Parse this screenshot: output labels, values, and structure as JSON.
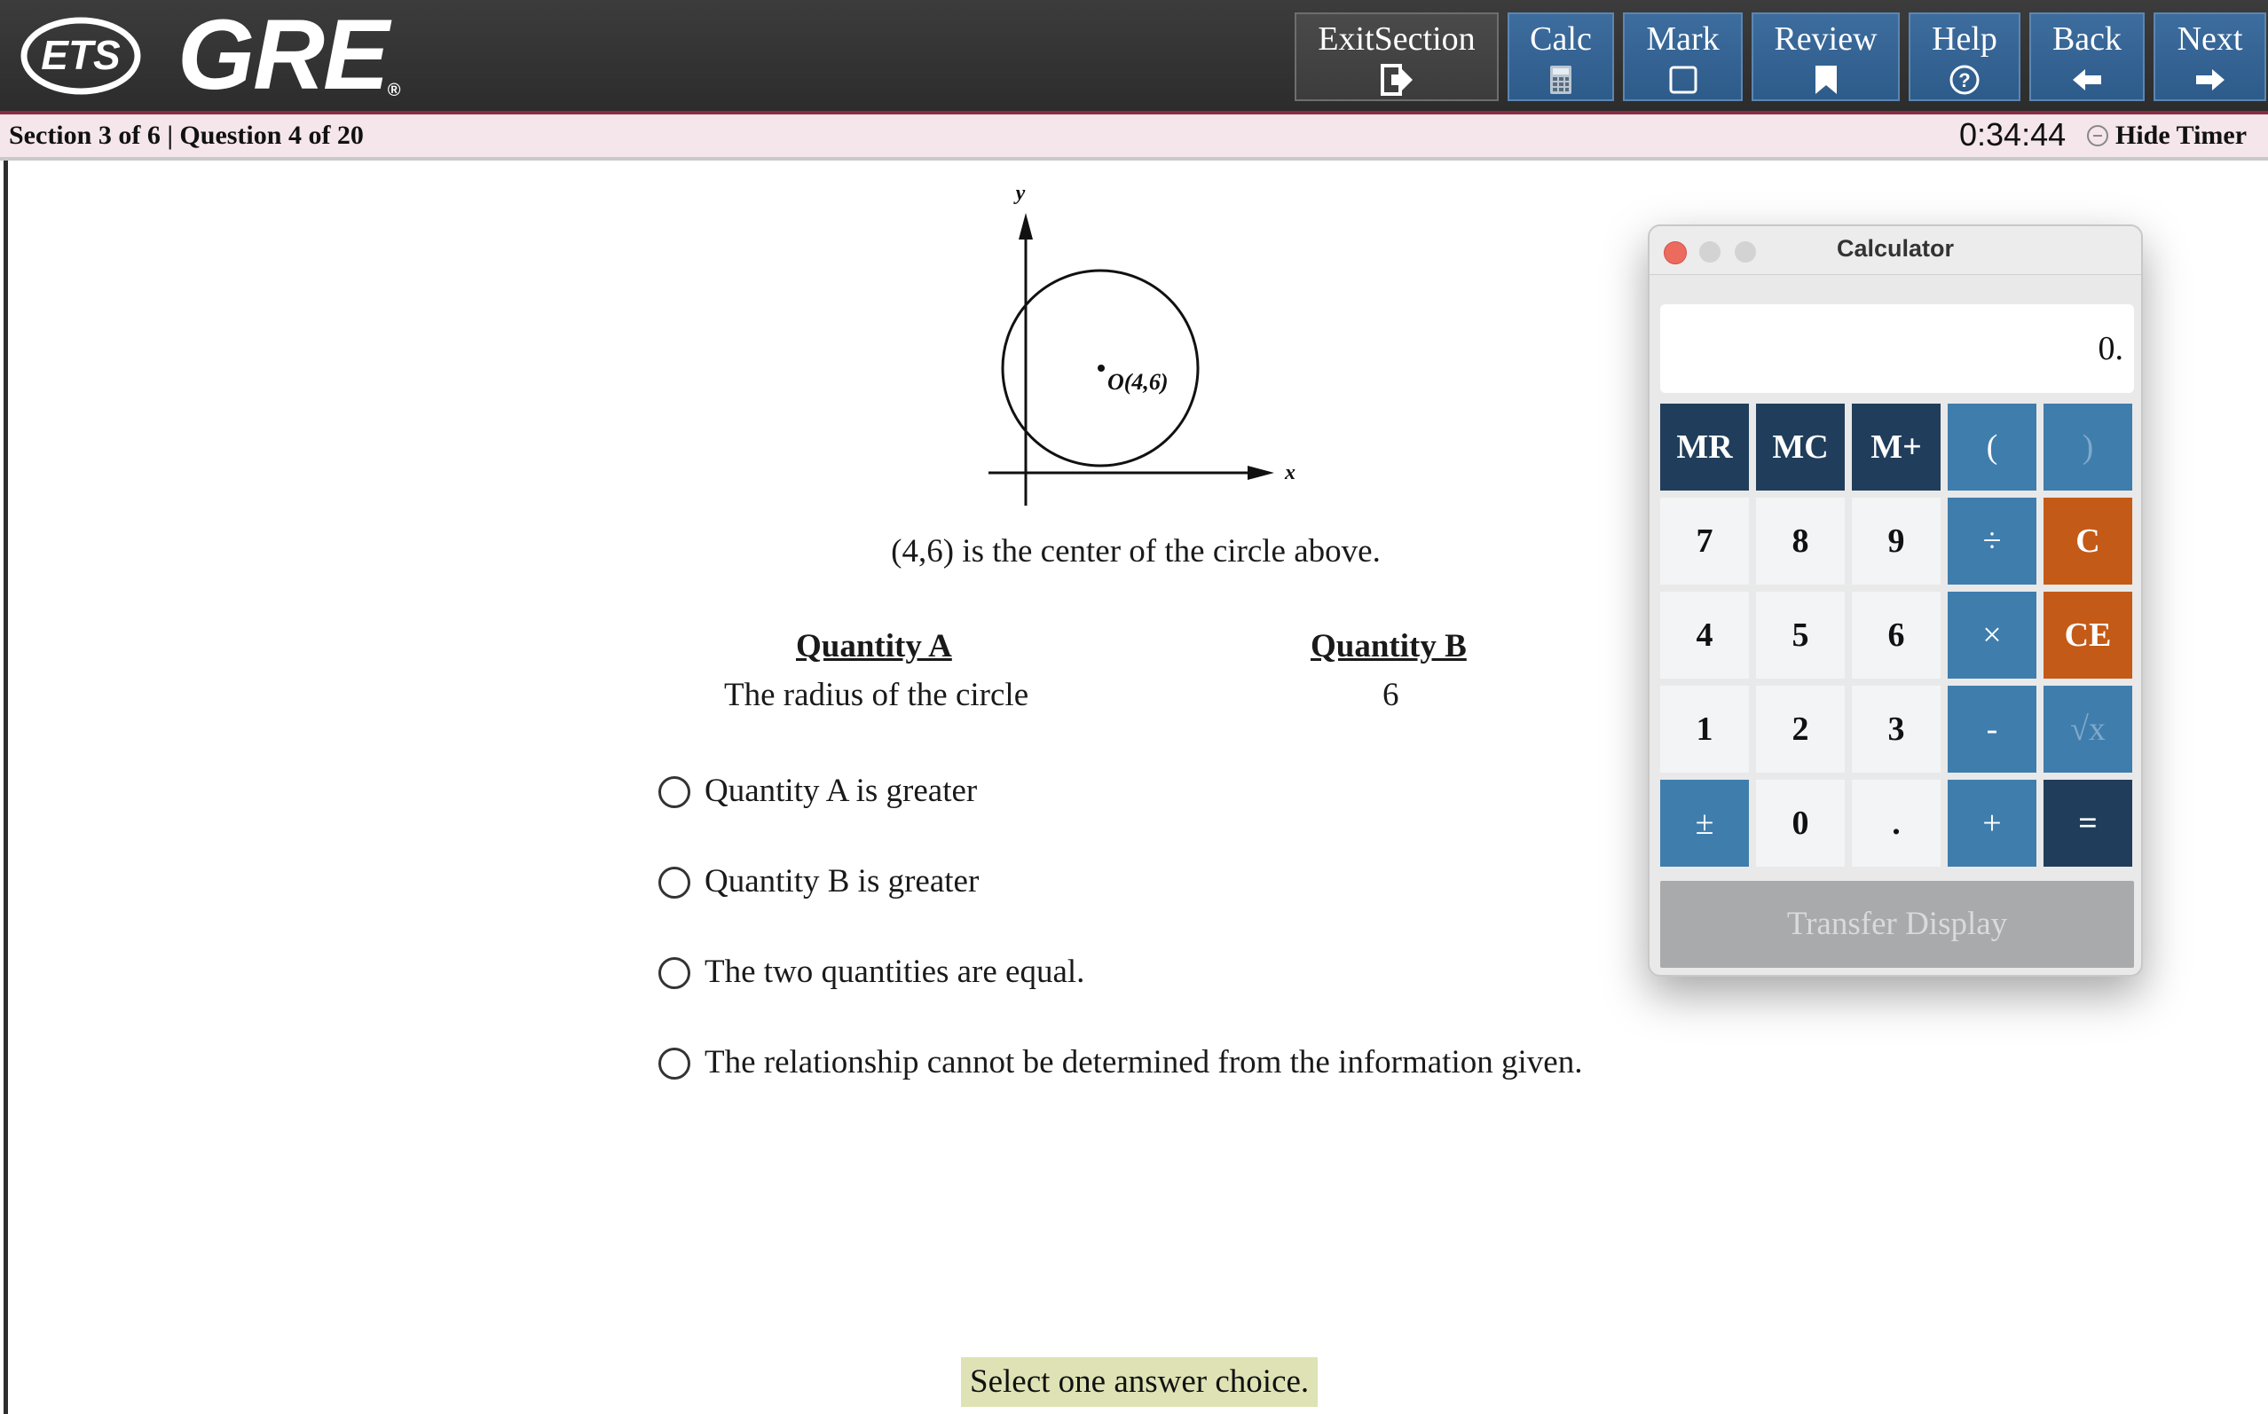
{
  "header": {
    "logo_ets": "ETS",
    "logo_gre": "GRE",
    "buttons": [
      {
        "label": "ExitSection",
        "icon": "exit-icon"
      },
      {
        "label": "Calc",
        "icon": "calculator-icon"
      },
      {
        "label": "Mark",
        "icon": "checkbox-icon"
      },
      {
        "label": "Review",
        "icon": "bookmark-icon"
      },
      {
        "label": "Help",
        "icon": "help-icon"
      },
      {
        "label": "Back",
        "icon": "arrow-left-icon"
      },
      {
        "label": "Next",
        "icon": "arrow-right-icon"
      }
    ]
  },
  "status": {
    "section_info": "Section 3 of 6 | Question 4 of 20",
    "timer": "0:34:44",
    "hide_timer": "Hide Timer"
  },
  "question": {
    "figure": {
      "y_label": "y",
      "x_label": "x",
      "point_label": "O(4,6)"
    },
    "stem": "(4,6) is the center of the circle above.",
    "quantity_a_head": "Quantity A",
    "quantity_b_head": "Quantity B",
    "quantity_a_value": "The radius of the circle",
    "quantity_b_value": "6",
    "choices": [
      "Quantity A is greater",
      "Quantity B is greater",
      "The two quantities are equal.",
      "The relationship cannot be determined from the information given."
    ],
    "hint": "Select one answer choice."
  },
  "calculator": {
    "title": "Calculator",
    "display": "0.",
    "keys": [
      [
        "MR",
        "MC",
        "M+",
        "(",
        ")"
      ],
      [
        "7",
        "8",
        "9",
        "÷",
        "C"
      ],
      [
        "4",
        "5",
        "6",
        "×",
        "CE"
      ],
      [
        "1",
        "2",
        "3",
        "-",
        "√x"
      ],
      [
        "±",
        "0",
        ".",
        "+",
        "="
      ]
    ],
    "transfer": "Transfer Display"
  },
  "colors": {
    "header_bg": "#333333",
    "accent_border": "#8a2c45",
    "nav_button": "#2d5b8a",
    "status_bg": "#f4e6ea",
    "calc_dark": "#203e5b",
    "calc_blue": "#3f7dad",
    "calc_orange": "#c45a17",
    "hint_bg": "#dfe2b4"
  }
}
